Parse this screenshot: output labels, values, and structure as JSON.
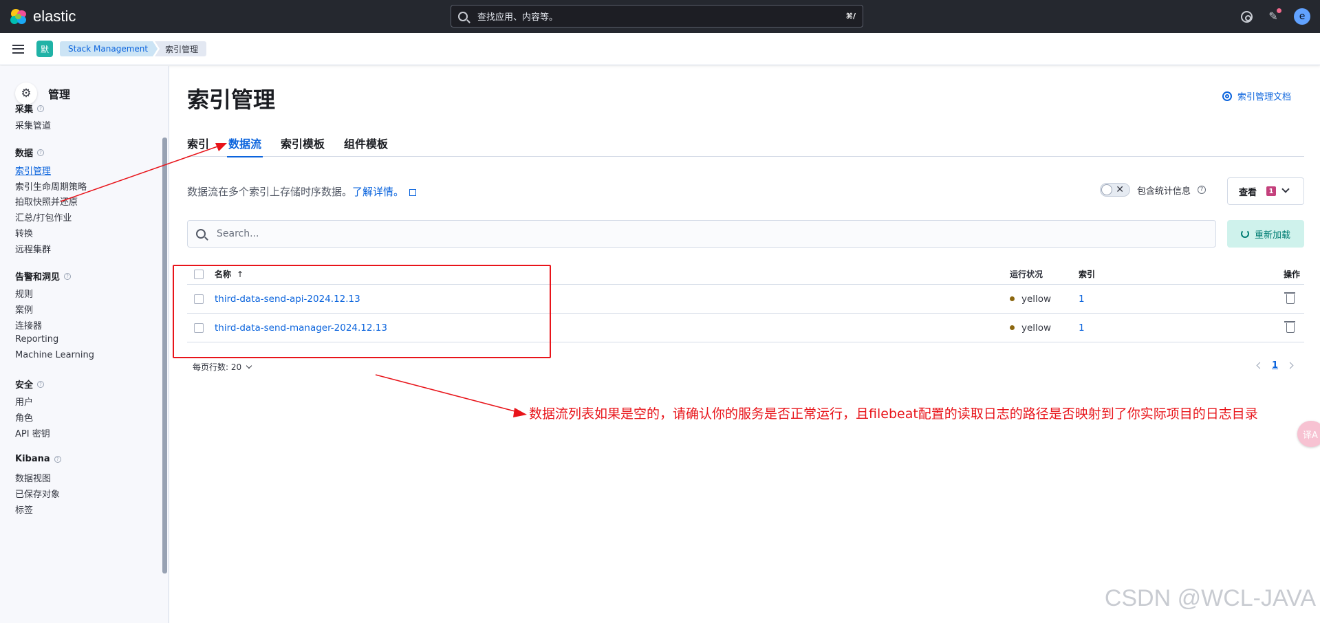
{
  "topbar": {
    "brand": "elastic",
    "search_placeholder": "查找应用、内容等。",
    "search_shortcut": "⌘/",
    "avatar_letter": "e"
  },
  "subbar": {
    "space_label": "默",
    "breadcrumbs": [
      "Stack Management",
      "索引管理"
    ]
  },
  "sidebar": {
    "title": "管理",
    "sections": [
      {
        "label": "采集",
        "items": [
          "采集管道"
        ]
      },
      {
        "label": "数据",
        "items": [
          "索引管理",
          "索引生命周期策略",
          "拍取快照并还原",
          "汇总/打包作业",
          "转换",
          "远程集群"
        ]
      },
      {
        "label": "告警和洞见",
        "items": [
          "规则",
          "案例",
          "连接器",
          "Reporting",
          "Machine Learning"
        ]
      },
      {
        "label": "安全",
        "items": [
          "用户",
          "角色",
          "API 密钥"
        ]
      },
      {
        "label": "Kibana",
        "items": [
          "数据视图",
          "已保存对象",
          "标签"
        ]
      }
    ],
    "active_item": "索引管理"
  },
  "main": {
    "title": "索引管理",
    "doc_link": "索引管理文档",
    "tabs": [
      "索引",
      "数据流",
      "索引模板",
      "组件模板"
    ],
    "active_tab": "数据流",
    "description": "数据流在多个索引上存储时序数据。",
    "learn_more": "了解详情。",
    "include_stats_label": "包含统计信息",
    "view_button": "查看",
    "view_badge": "1",
    "search_placeholder": "Search...",
    "reload_button": "重新加载",
    "table": {
      "columns": [
        "名称",
        "运行状况",
        "索引",
        "操作"
      ],
      "sort_indicator": "↑",
      "rows": [
        {
          "name": "third-data-send-api-2024.12.13",
          "health": "yellow",
          "indices": "1"
        },
        {
          "name": "third-data-send-manager-2024.12.13",
          "health": "yellow",
          "indices": "1"
        }
      ]
    },
    "rows_per_page": "每页行数: 20",
    "current_page": "1"
  },
  "annotation": {
    "text": "数据流列表如果是空的，请确认你的服务是否正常运行，且filebeat配置的读取日志的路径是否映射到了你实际项目的日志目录"
  },
  "watermark": "CSDN @WCL-JAVA",
  "fab_label": "译A",
  "colors": {
    "accent": "#0b64dd",
    "header_bg": "#25282f",
    "health_yellow": "#8c6710",
    "annotation_red": "#e8141a",
    "space_badge": "#20b2a6"
  }
}
